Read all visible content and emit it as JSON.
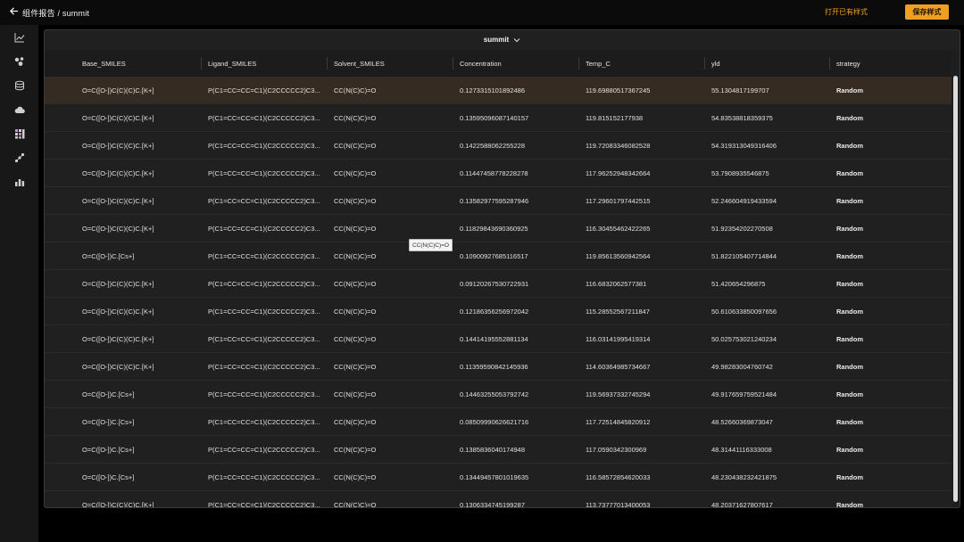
{
  "header": {
    "breadcrumb": "组件报告 / summit",
    "open_style_label": "打开已有样式",
    "save_style_label": "保存样式"
  },
  "sidebar": {
    "icons": [
      "line-chart-icon",
      "scatter-icon",
      "database-icon",
      "cloud-icon",
      "grid-icon",
      "bubble-chart-icon",
      "bar-chart-icon"
    ]
  },
  "panel": {
    "title": "summit"
  },
  "table": {
    "columns": [
      "Base_SMILES",
      "Ligand_SMILES",
      "Solvent_SMILES",
      "Concentration",
      "Temp_C",
      "yld",
      "strategy"
    ],
    "rows": [
      [
        "O=C([O-])C(C)(C)C.[K+]",
        "P(C1=CC=CC=C1)(C2CCCCC2)C3...",
        "CC(N(C)C)=O",
        "0.1273315101892486",
        "119.69880517367245",
        "55.1304817199707",
        "Random"
      ],
      [
        "O=C([O-])C(C)(C)C.[K+]",
        "P(C1=CC=CC=C1)(C2CCCCC2)C3...",
        "CC(N(C)C)=O",
        "0.13595096087140157",
        "119.815152177938",
        "54.83538818359375",
        "Random"
      ],
      [
        "O=C([O-])C(C)(C)C.[K+]",
        "P(C1=CC=CC=C1)(C2CCCCC2)C3...",
        "CC(N(C)C)=O",
        "0.1422588062255228",
        "119.72083346082528",
        "54.319313049316406",
        "Random"
      ],
      [
        "O=C([O-])C(C)(C)C.[K+]",
        "P(C1=CC=CC=C1)(C2CCCCC2)C3...",
        "CC(N(C)C)=O",
        "0.11447458778228278",
        "117.96252948342664",
        "53.7908935546875",
        "Random"
      ],
      [
        "O=C([O-])C(C)(C)C.[K+]",
        "P(C1=CC=CC=C1)(C2CCCCC2)C3...",
        "CC(N(C)C)=O",
        "0.13582977595287946",
        "117.29601797442515",
        "52.246604919433594",
        "Random"
      ],
      [
        "O=C([O-])C(C)(C)C.[K+]",
        "P(C1=CC=CC=C1)(C2CCCCC2)C3...",
        "CC(N(C)C)=O",
        "0.11829843690360925",
        "116.30455462422265",
        "51.92354202270508",
        "Random"
      ],
      [
        "O=C([O-])C.[Cs+]",
        "P(C1=CC=CC=C1)(C2CCCCC2)C3...",
        "CC(N(C)C)=O",
        "0.10900927685116517",
        "119.85613560942564",
        "51.822105407714844",
        "Random"
      ],
      [
        "O=C([O-])C(C)(C)C.[K+]",
        "P(C1=CC=CC=C1)(C2CCCCC2)C3...",
        "CC(N(C)C)=O",
        "0.09120267530722931",
        "116.6832062577381",
        "51.420654296875",
        "Random"
      ],
      [
        "O=C([O-])C(C)(C)C.[K+]",
        "P(C1=CC=CC=C1)(C2CCCCC2)C3...",
        "CC(N(C)C)=O",
        "0.12186356256972042",
        "115.28552567211847",
        "50.610633850097656",
        "Random"
      ],
      [
        "O=C([O-])C(C)(C)C.[K+]",
        "P(C1=CC=CC=C1)(C2CCCCC2)C3...",
        "CC(N(C)C)=O",
        "0.14414195552881134",
        "116.03141995419314",
        "50.025753021240234",
        "Random"
      ],
      [
        "O=C([O-])C(C)(C)C.[K+]",
        "P(C1=CC=CC=C1)(C2CCCCC2)C3...",
        "CC(N(C)C)=O",
        "0.11359590842145936",
        "114.60364985734667",
        "49.98283004760742",
        "Random"
      ],
      [
        "O=C([O-])C.[Cs+]",
        "P(C1=CC=CC=C1)(C2CCCCC2)C3...",
        "CC(N(C)C)=O",
        "0.14463255053792742",
        "119.56937332745294",
        "49.917659759521484",
        "Random"
      ],
      [
        "O=C([O-])C.[Cs+]",
        "P(C1=CC=CC=C1)(C2CCCCC2)C3...",
        "CC(N(C)C)=O",
        "0.08509990626621716",
        "117.72514845820912",
        "48.52660369873047",
        "Random"
      ],
      [
        "O=C([O-])C.[Cs+]",
        "P(C1=CC=CC=C1)(C2CCCCC2)C3...",
        "CC(N(C)C)=O",
        "0.1385836040174948",
        "117.0590342300969",
        "48.31441116333008",
        "Random"
      ],
      [
        "O=C([O-])C.[Cs+]",
        "P(C1=CC=CC=C1)(C2CCCCC2)C3...",
        "CC(N(C)C)=O",
        "0.13449457801019635",
        "116.58572854620033",
        "48.230438232421875",
        "Random"
      ],
      [
        "O=C([O-])C(C)(C)C.[K+]",
        "P(C1=CC=CC=C1)(C2CCCCC2)C3...",
        "CC(N(C)C)=O",
        "0.1306334745199287",
        "113.73777013400053",
        "48.20371627807617",
        "Random"
      ]
    ]
  },
  "tooltip": {
    "text": "CC(N(C)C)=O"
  },
  "colors": {
    "accent": "#f0a020",
    "selected_row": "#362b22"
  }
}
